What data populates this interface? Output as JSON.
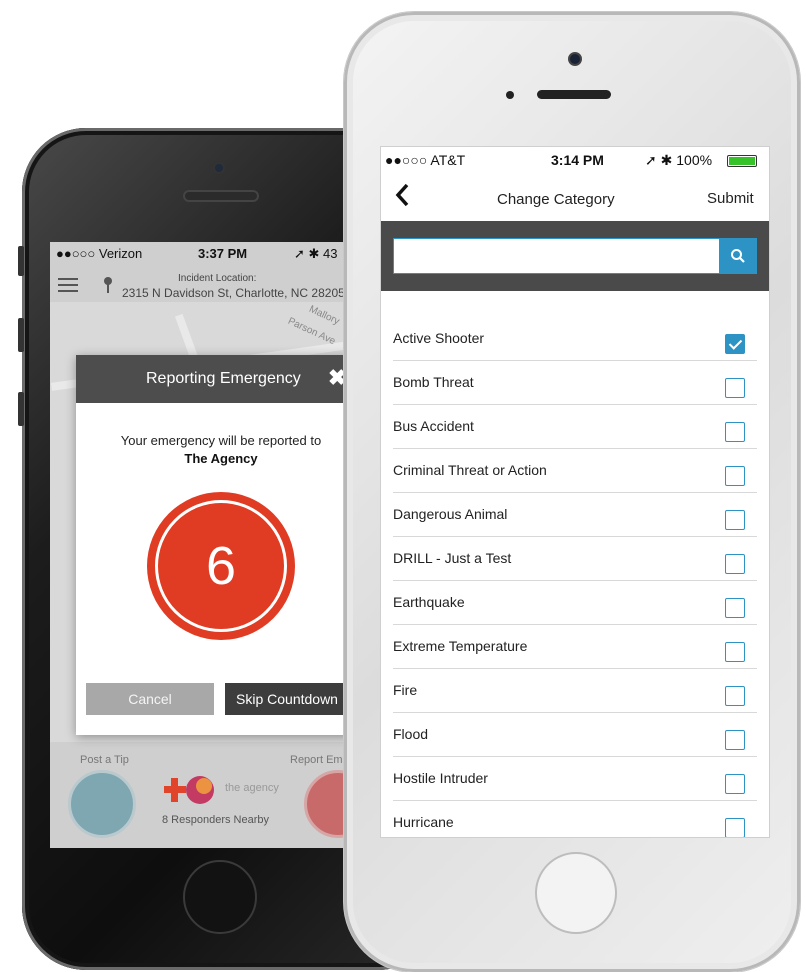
{
  "back_phone": {
    "status": {
      "carrier": "●●○○○ Verizon",
      "time": "3:37 PM",
      "right": "➚ ✱ 43"
    },
    "incident_label": "Incident Location:",
    "incident_address": "2315 N Davidson St, Charlotte, NC 28205",
    "map_streets": [
      "Mallory",
      "Parson Ave"
    ],
    "modal": {
      "title": "Reporting Emergency",
      "message": "Your emergency will be reported to",
      "agency": "The Agency",
      "countdown": "6",
      "cancel_label": "Cancel",
      "skip_label": "Skip Countdown"
    },
    "post_tip_label": "Post a Tip",
    "report_label": "Report Eme",
    "logo_text": "the agency",
    "responders": "8 Responders Nearby",
    "colors": {
      "countdown": "#e03b23",
      "tip": "#7fa7b1",
      "report": "#c96a6a"
    }
  },
  "front_phone": {
    "status": {
      "carrier": "●●○○○ AT&T",
      "time": "3:14 PM",
      "right": "➚ ✱ 100%"
    },
    "nav": {
      "back": "‹",
      "title": "Change Category",
      "submit": "Submit"
    },
    "search": {
      "placeholder": "",
      "value": ""
    },
    "categories": [
      {
        "label": "Active Shooter",
        "checked": true
      },
      {
        "label": "Bomb Threat",
        "checked": false
      },
      {
        "label": "Bus Accident",
        "checked": false
      },
      {
        "label": "Criminal Threat or Action",
        "checked": false
      },
      {
        "label": "Dangerous Animal",
        "checked": false
      },
      {
        "label": "DRILL - Just a Test",
        "checked": false
      },
      {
        "label": "Earthquake",
        "checked": false
      },
      {
        "label": "Extreme Temperature",
        "checked": false
      },
      {
        "label": "Fire",
        "checked": false
      },
      {
        "label": "Flood",
        "checked": false
      },
      {
        "label": "Hostile Intruder",
        "checked": false
      },
      {
        "label": "Hurricane",
        "checked": false
      }
    ],
    "colors": {
      "accent": "#2d93c5",
      "search_bar": "#4a4a4a",
      "battery": "#36c32a"
    }
  }
}
